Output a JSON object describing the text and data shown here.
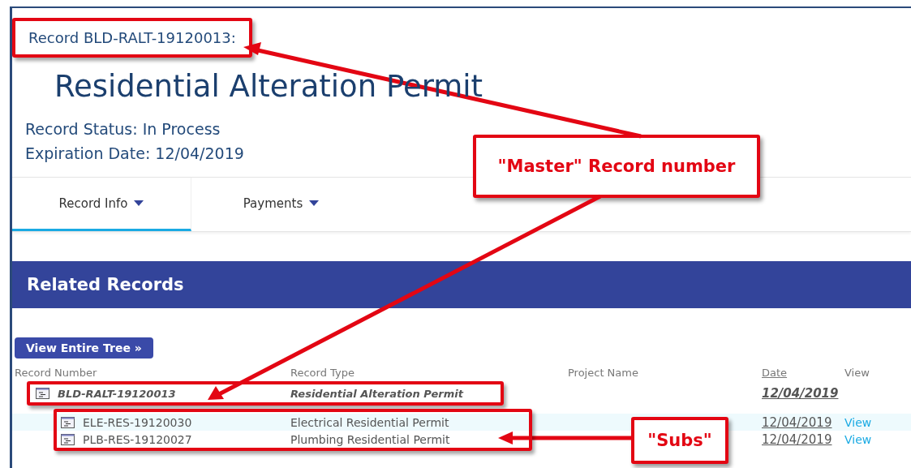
{
  "record_heading": "Record BLD-RALT-19120013:",
  "title": "Residential Alteration Permit",
  "status": "Record Status: In Process",
  "expiration": "Expiration Date: 12/04/2019",
  "tabs": [
    {
      "label": "Record Info",
      "selected": true
    },
    {
      "label": "Payments",
      "selected": false
    }
  ],
  "related": {
    "title": "Related Records",
    "button": "View Entire Tree »",
    "columns": [
      "Record Number",
      "Record Type",
      "Project Name",
      "Date",
      "View"
    ],
    "rows": [
      {
        "kind": "master",
        "number": "BLD-RALT-19120013",
        "type": "Residential Alteration Permit",
        "date": "12/04/2019"
      },
      {
        "kind": "sub",
        "number": "ELE-RES-19120030",
        "type": "Electrical Residential Permit",
        "date": "12/04/2019",
        "view": "View"
      },
      {
        "kind": "sub",
        "number": "PLB-RES-19120027",
        "type": "Plumbing Residential Permit",
        "date": "12/04/2019",
        "view": "View"
      }
    ]
  },
  "annotations": [
    {
      "text": "\"Master\" Record number"
    },
    {
      "text": "\"Subs\""
    }
  ]
}
